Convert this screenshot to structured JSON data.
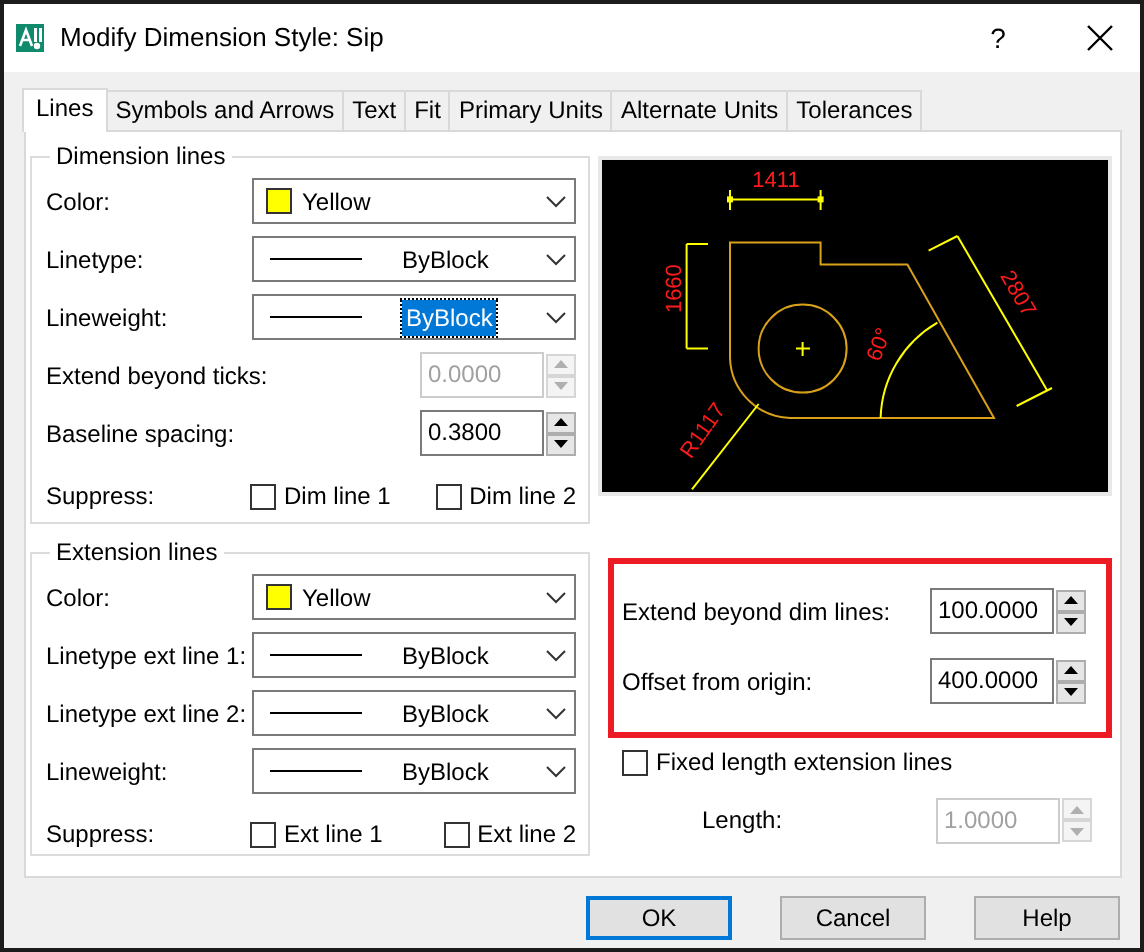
{
  "window": {
    "title": "Modify Dimension Style: Sip",
    "help": "?"
  },
  "tabs": [
    {
      "label": "Lines",
      "selected": true
    },
    {
      "label": "Symbols and Arrows",
      "selected": false
    },
    {
      "label": "Text",
      "selected": false
    },
    {
      "label": "Fit",
      "selected": false
    },
    {
      "label": "Primary Units",
      "selected": false
    },
    {
      "label": "Alternate Units",
      "selected": false
    },
    {
      "label": "Tolerances",
      "selected": false
    }
  ],
  "dimension_lines": {
    "title": "Dimension lines",
    "rows": [
      {
        "kind": "color_combo",
        "label": "Color:",
        "value": "Yellow",
        "color": "#ffff00",
        "focused": false
      },
      {
        "kind": "line_combo",
        "label": "Linetype:",
        "value": "ByBlock",
        "focused": false
      },
      {
        "kind": "line_combo",
        "label": "Lineweight:",
        "value": "ByBlock",
        "focused": true
      },
      {
        "kind": "spin",
        "label": "Extend beyond ticks:",
        "value": "0.0000",
        "disabled": true
      },
      {
        "kind": "spin",
        "label": "Baseline spacing:",
        "value": "0.3800",
        "disabled": false
      },
      {
        "kind": "checks",
        "label": "Suppress:",
        "options": [
          {
            "label": "Dim line 1",
            "checked": false
          },
          {
            "label": "Dim line 2",
            "checked": false
          }
        ]
      }
    ]
  },
  "extension_lines": {
    "title": "Extension lines",
    "rows": [
      {
        "kind": "color_combo",
        "label": "Color:",
        "value": "Yellow",
        "color": "#ffff00",
        "focused": false
      },
      {
        "kind": "line_combo",
        "label": "Linetype ext line 1:",
        "value": "ByBlock",
        "focused": false
      },
      {
        "kind": "line_combo",
        "label": "Linetype ext line 2:",
        "value": "ByBlock",
        "focused": false
      },
      {
        "kind": "line_combo",
        "label": "Lineweight:",
        "value": "ByBlock",
        "focused": false
      },
      {
        "kind": "checks",
        "label": "Suppress:",
        "options": [
          {
            "label": "Ext line 1",
            "checked": false
          },
          {
            "label": "Ext line 2",
            "checked": false
          }
        ]
      }
    ]
  },
  "preview": {
    "labels": [
      "1411",
      "1660",
      "2807",
      "60°",
      "R1117"
    ]
  },
  "offsets": {
    "highlighted": true,
    "rows": [
      {
        "kind": "spin",
        "label": "Extend beyond dim lines:",
        "value": "100.0000",
        "disabled": false
      },
      {
        "kind": "spin",
        "label": "Offset from origin:",
        "value": "400.0000",
        "disabled": false
      }
    ]
  },
  "fixed_length": {
    "label": "Fixed length extension lines",
    "checked": false
  },
  "length": {
    "kind": "spin",
    "label": "Length:",
    "value": "1.0000",
    "disabled": true
  },
  "buttons": [
    {
      "label": "OK",
      "default": true
    },
    {
      "label": "Cancel",
      "default": false
    },
    {
      "label": "Help",
      "default": false
    }
  ]
}
